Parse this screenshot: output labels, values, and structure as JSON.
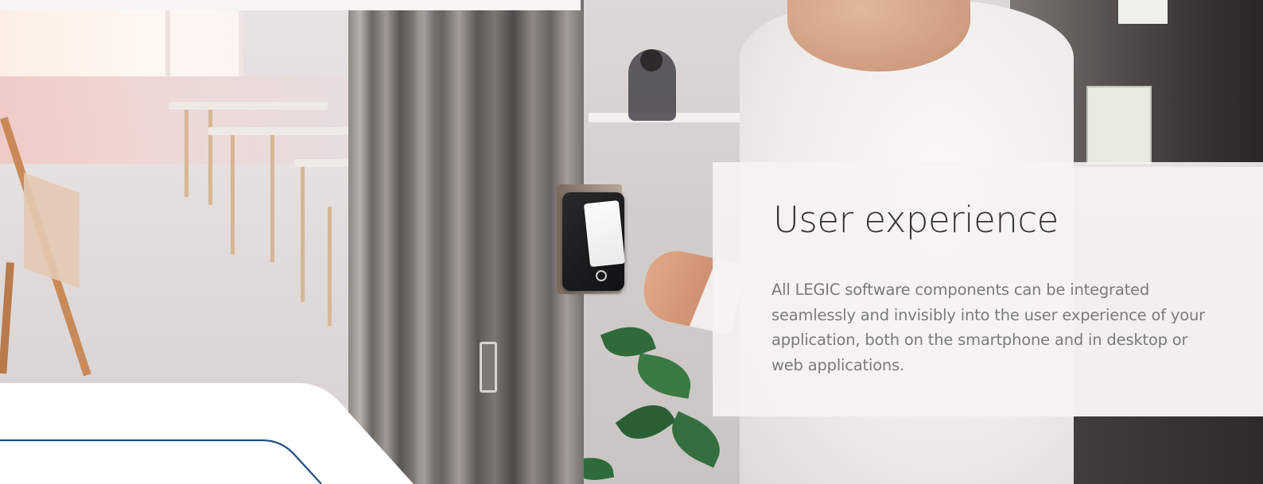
{
  "section": {
    "title": "User experience",
    "body": "All LEGIC software components can be integrated seamlessly and invisibly into the user experience of your application, both on the smartphone and in desktop or web applications."
  },
  "colors": {
    "accent_line": "#1f4e85",
    "panel_background": "#f6f3f3",
    "title_text": "#333333",
    "body_text": "#7b7b7b"
  },
  "image": {
    "description_icon": "access-card-reader-photo"
  }
}
